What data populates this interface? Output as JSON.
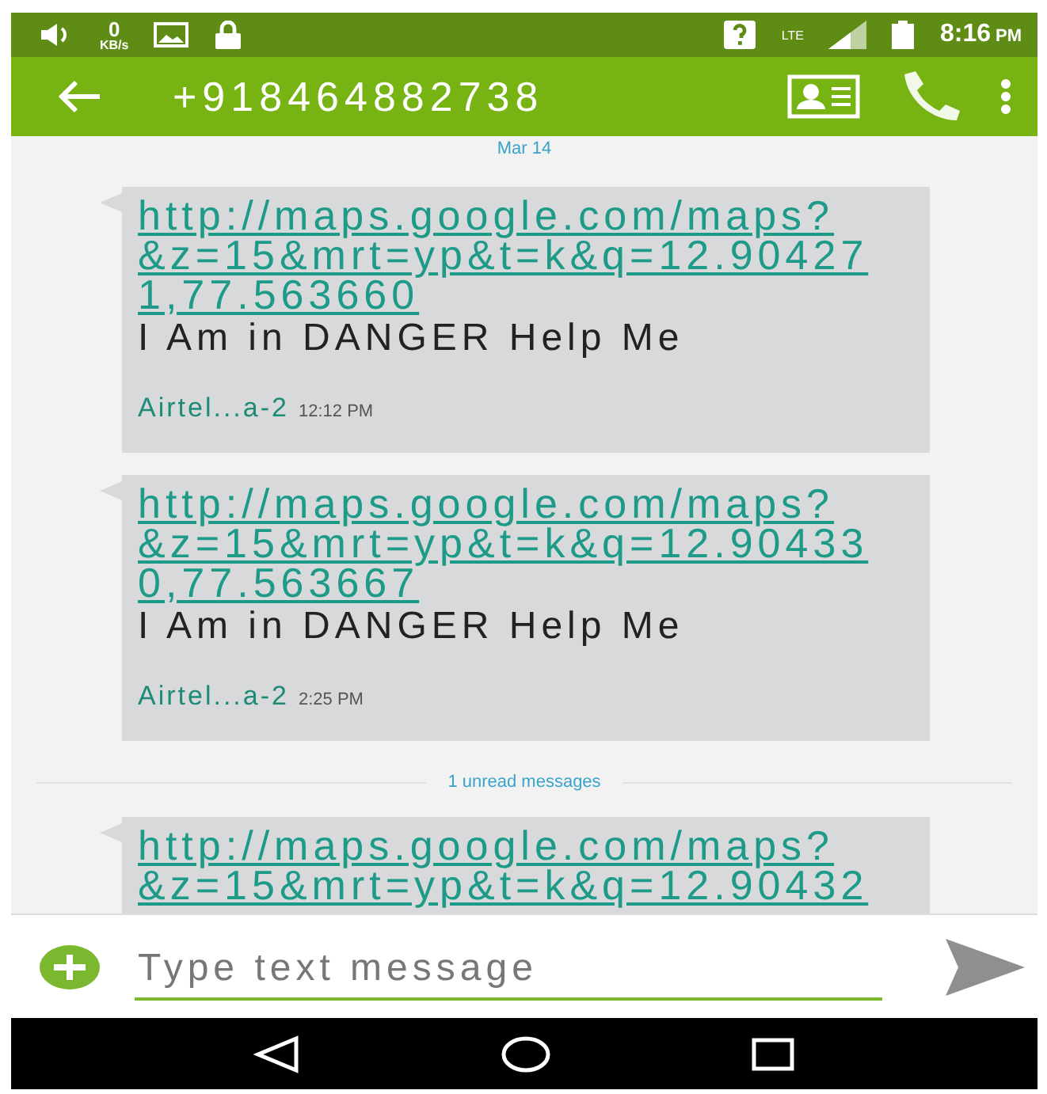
{
  "status_bar": {
    "data_rate": "0",
    "data_unit": "KB/s",
    "network": "LTE",
    "time": "8:16",
    "period": "PM"
  },
  "toolbar": {
    "title": "+918464882738"
  },
  "items": [
    {
      "kind": "date",
      "text": "Mar 14"
    },
    {
      "kind": "message",
      "link_lines": [
        "http://maps.google.com/maps?",
        "&z=15&mrt=yp&t=k&q=12.90427",
        "1,77.563660"
      ],
      "body": "I Am in DANGER Help Me",
      "sender": "Airtel...a-2",
      "time": "12:12 PM"
    },
    {
      "kind": "message",
      "link_lines": [
        "http://maps.google.com/maps?",
        "&z=15&mrt=yp&t=k&q=12.90433",
        "0,77.563667"
      ],
      "body": "I Am in DANGER Help Me",
      "sender": "Airtel...a-2",
      "time": "2:25 PM"
    },
    {
      "kind": "divider",
      "text": "1 unread messages"
    },
    {
      "kind": "message",
      "link_lines": [
        "http://maps.google.com/maps?",
        "&z=15&mrt=yp&t=k&q=12.90432"
      ]
    }
  ],
  "composer": {
    "placeholder": "Type text message"
  }
}
